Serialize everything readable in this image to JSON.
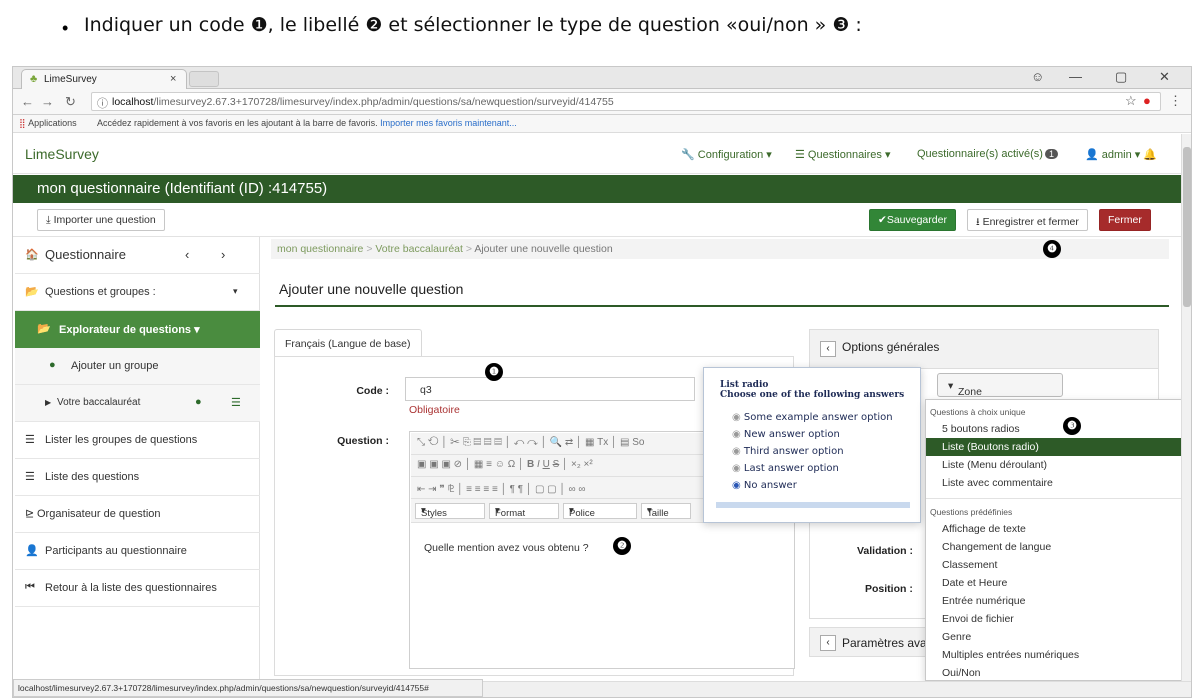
{
  "caption": {
    "bullet": "•",
    "text": "Indiquer un code ❶, le libellé ❷ et sélectionner le type de question «oui/non » ❸ :"
  },
  "browser": {
    "tab_title": "LimeSurvey",
    "url_host": "localhost",
    "url_path": "/limesurvey2.67.3+170728/limesurvey/index.php/admin/questions/sa/newquestion/surveyid/414755",
    "bookmarks_apps": "Applications",
    "bookmarks_note": "Accédez rapidement à vos favoris en les ajoutant à la barre de favoris.",
    "bookmarks_link": "Importer mes favoris maintenant..."
  },
  "nav": {
    "brand": "LimeSurvey",
    "configuration": "Configuration",
    "questionnaires": "Questionnaires",
    "active": "Questionnaire(s) activé(s)",
    "active_count": "1",
    "admin": "admin"
  },
  "survey_title": "mon questionnaire (Identifiant (ID) :414755)",
  "toolbar": {
    "import": "Importer une question",
    "save": "Sauvegarder",
    "save_close": "Enregistrer et fermer",
    "close": "Fermer"
  },
  "sidebar": {
    "title": "Questionnaire",
    "items": [
      {
        "label": "Questions et groupes :"
      },
      {
        "label": "Explorateur de questions"
      },
      {
        "label": "Ajouter un groupe"
      },
      {
        "label": "Votre baccalauréat"
      },
      {
        "label": "Lister les groupes de questions"
      },
      {
        "label": "Liste des questions"
      },
      {
        "label": "Organisateur de question"
      },
      {
        "label": "Participants au questionnaire"
      },
      {
        "label": "Retour à la liste des questionnaires"
      }
    ]
  },
  "breadcrumb": [
    "mon questionnaire",
    "Votre baccalauréat",
    "Ajouter une nouvelle question"
  ],
  "page_title": "Ajouter une nouvelle question",
  "lang_tab": "Français (Langue de base)",
  "form": {
    "code_label": "Code :",
    "code_value": "q3",
    "required": "Obligatoire",
    "question_label": "Question :",
    "question_text": "Quelle mention avez vous obtenu ?",
    "editor_styles": "Styles",
    "editor_format": "Format",
    "editor_font": "Police",
    "editor_size": "Taille"
  },
  "right": {
    "options_title": "Options générales",
    "type_button": "Zone de texte long",
    "validation": "Validation :",
    "position": "Position :",
    "advanced": "Paramètres ava"
  },
  "menu": {
    "group1": "Questions à choix unique",
    "items1": [
      "5 boutons radios",
      "Liste (Boutons radio)",
      "Liste (Menu déroulant)",
      "Liste avec commentaire"
    ],
    "group2": "Questions prédéfinies",
    "items2": [
      "Affichage de texte",
      "Changement de langue",
      "Classement",
      "Date et Heure",
      "Entrée numérique",
      "Envoi de fichier",
      "Genre",
      "Multiples entrées numériques",
      "Oui/Non"
    ]
  },
  "preview": {
    "title": "List radio",
    "subtitle": "Choose one of the following answers",
    "options": [
      "Some example answer option",
      "New answer option",
      "Third answer option",
      "Last answer option",
      "No answer"
    ]
  },
  "markers": [
    "❶",
    "❷",
    "❸",
    "❹"
  ],
  "status_url": "localhost/limesurvey2.67.3+170728/limesurvey/index.php/admin/questions/sa/newquestion/surveyid/414755#"
}
